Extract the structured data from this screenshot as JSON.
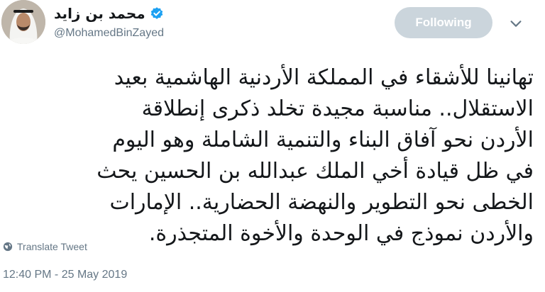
{
  "author": {
    "display_name": "محمد بن زايد",
    "handle": "@MohamedBinZayed",
    "verified": true,
    "avatar_icon": "profile-photo"
  },
  "follow_button": {
    "label": "Following"
  },
  "tweet": {
    "text": "تهانينا للأشقاء في المملكة الأردنية الهاشمية بعيد\nالاستقلال.. مناسبة مجيدة تخلد ذكرى إنطلاقة\nالأردن نحو آفاق البناء والتنمية الشاملة وهو اليوم\nفي ظل قيادة أخي الملك عبدالله بن الحسين يحث\nالخطى نحو التطوير والنهضة الحضارية.. الإمارات\nوالأردن نموذج في الوحدة والأخوة المتجذرة.",
    "translate_label": "Translate Tweet",
    "timestamp": "12:40 PM - 25 May 2019"
  },
  "colors": {
    "accent_verified": "#1da1f2",
    "follow_bg": "#cbd5dc",
    "muted": "#657786"
  }
}
